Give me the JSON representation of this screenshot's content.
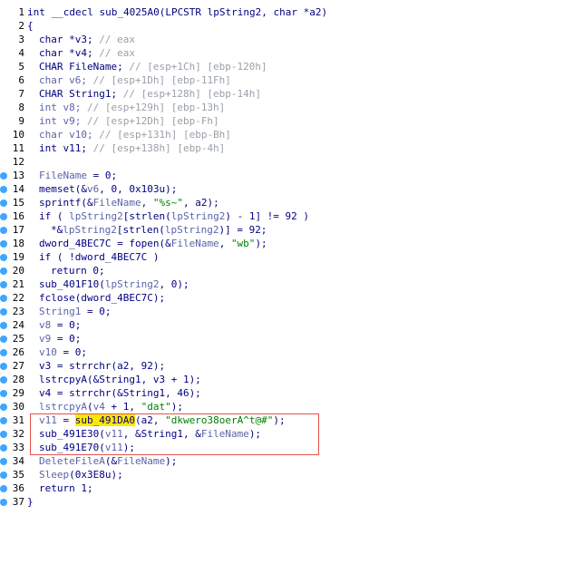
{
  "lines": [
    {
      "n": "1",
      "bp": false,
      "segs": [
        [
          "k",
          "int __cdecl sub_4025A0(LPCSTR lpString2, char *a2)"
        ]
      ]
    },
    {
      "n": "2",
      "bp": false,
      "segs": [
        [
          "k",
          "{"
        ]
      ]
    },
    {
      "n": "3",
      "bp": false,
      "ind": 1,
      "segs": [
        [
          "k",
          "char *v3; "
        ],
        [
          "c",
          "// eax"
        ]
      ]
    },
    {
      "n": "4",
      "bp": false,
      "ind": 1,
      "segs": [
        [
          "k",
          "char *v4; "
        ],
        [
          "c",
          "// eax"
        ]
      ]
    },
    {
      "n": "5",
      "bp": false,
      "ind": 1,
      "segs": [
        [
          "k",
          "CHAR FileName; "
        ],
        [
          "c",
          "// [esp+1Ch] [ebp-120h]"
        ]
      ]
    },
    {
      "n": "6",
      "bp": false,
      "ind": 1,
      "segs": [
        [
          "v",
          "char v6; "
        ],
        [
          "c",
          "// [esp+1Dh] [ebp-11Fh]"
        ]
      ]
    },
    {
      "n": "7",
      "bp": false,
      "ind": 1,
      "segs": [
        [
          "k",
          "CHAR String1; "
        ],
        [
          "c",
          "// [esp+128h] [ebp-14h]"
        ]
      ]
    },
    {
      "n": "8",
      "bp": false,
      "ind": 1,
      "segs": [
        [
          "v",
          "int v8; "
        ],
        [
          "c",
          "// [esp+129h] [ebp-13h]"
        ]
      ]
    },
    {
      "n": "9",
      "bp": false,
      "ind": 1,
      "segs": [
        [
          "v",
          "int v9; "
        ],
        [
          "c",
          "// [esp+12Dh] [ebp-Fh]"
        ]
      ]
    },
    {
      "n": "10",
      "bp": false,
      "ind": 1,
      "segs": [
        [
          "v",
          "char v10; "
        ],
        [
          "c",
          "// [esp+131h] [ebp-Bh]"
        ]
      ]
    },
    {
      "n": "11",
      "bp": false,
      "ind": 1,
      "segs": [
        [
          "k",
          "int v11; "
        ],
        [
          "c",
          "// [esp+138h] [ebp-4h]"
        ]
      ]
    },
    {
      "n": "12",
      "bp": false,
      "segs": [
        [
          "k",
          ""
        ]
      ]
    },
    {
      "n": "13",
      "bp": true,
      "ind": 1,
      "segs": [
        [
          "v",
          "FileName"
        ],
        [
          "k",
          " = 0;"
        ]
      ]
    },
    {
      "n": "14",
      "bp": true,
      "ind": 1,
      "segs": [
        [
          "k",
          "memset(&"
        ],
        [
          "v",
          "v6"
        ],
        [
          "k",
          ", 0, 0x103u);"
        ]
      ]
    },
    {
      "n": "15",
      "bp": true,
      "ind": 1,
      "segs": [
        [
          "k",
          "sprintf(&"
        ],
        [
          "v",
          "FileName"
        ],
        [
          "k",
          ", "
        ],
        [
          "s",
          "\"%s~\""
        ],
        [
          "k",
          ", a2);"
        ]
      ]
    },
    {
      "n": "16",
      "bp": true,
      "ind": 1,
      "segs": [
        [
          "k",
          "if ( "
        ],
        [
          "v",
          "lpString2"
        ],
        [
          "k",
          "[strlen("
        ],
        [
          "v",
          "lpString2"
        ],
        [
          "k",
          ") - 1] != 92 )"
        ]
      ]
    },
    {
      "n": "17",
      "bp": true,
      "ind": 2,
      "segs": [
        [
          "k",
          "*&"
        ],
        [
          "v",
          "lpString2"
        ],
        [
          "k",
          "[strlen("
        ],
        [
          "v",
          "lpString2"
        ],
        [
          "k",
          ")] = 92;"
        ]
      ]
    },
    {
      "n": "18",
      "bp": true,
      "ind": 1,
      "segs": [
        [
          "k",
          "dword_4BEC7C = fopen(&"
        ],
        [
          "v",
          "FileName"
        ],
        [
          "k",
          ", "
        ],
        [
          "s",
          "\"wb\""
        ],
        [
          "k",
          ");"
        ]
      ]
    },
    {
      "n": "19",
      "bp": true,
      "ind": 1,
      "segs": [
        [
          "k",
          "if ( !dword_4BEC7C )"
        ]
      ]
    },
    {
      "n": "20",
      "bp": true,
      "ind": 2,
      "segs": [
        [
          "k",
          "return 0;"
        ]
      ]
    },
    {
      "n": "21",
      "bp": true,
      "ind": 1,
      "segs": [
        [
          "k",
          "sub_401F10("
        ],
        [
          "v",
          "lpString2"
        ],
        [
          "k",
          ", 0);"
        ]
      ]
    },
    {
      "n": "22",
      "bp": true,
      "ind": 1,
      "segs": [
        [
          "k",
          "fclose(dword_4BEC7C);"
        ]
      ]
    },
    {
      "n": "23",
      "bp": true,
      "ind": 1,
      "segs": [
        [
          "v",
          "String1"
        ],
        [
          "k",
          " = 0;"
        ]
      ]
    },
    {
      "n": "24",
      "bp": true,
      "ind": 1,
      "segs": [
        [
          "v",
          "v8"
        ],
        [
          "k",
          " = 0;"
        ]
      ]
    },
    {
      "n": "25",
      "bp": true,
      "ind": 1,
      "segs": [
        [
          "v",
          "v9"
        ],
        [
          "k",
          " = 0;"
        ]
      ]
    },
    {
      "n": "26",
      "bp": true,
      "ind": 1,
      "segs": [
        [
          "v",
          "v10"
        ],
        [
          "k",
          " = 0;"
        ]
      ]
    },
    {
      "n": "27",
      "bp": true,
      "ind": 1,
      "segs": [
        [
          "k",
          "v3 = strrchr(a2, 92);"
        ]
      ]
    },
    {
      "n": "28",
      "bp": true,
      "ind": 1,
      "segs": [
        [
          "k",
          "lstrcpyA(&String1, v3 + 1);"
        ]
      ]
    },
    {
      "n": "29",
      "bp": true,
      "ind": 1,
      "segs": [
        [
          "k",
          "v4 = strrchr(&String1, 46);"
        ]
      ]
    },
    {
      "n": "30",
      "bp": true,
      "ind": 1,
      "segs": [
        [
          "v",
          "lstrcpyA"
        ],
        [
          "k",
          "("
        ],
        [
          "v",
          "v4"
        ],
        [
          "k",
          " + 1, "
        ],
        [
          "s",
          "\"dat\""
        ],
        [
          "k",
          ");"
        ]
      ]
    },
    {
      "n": "31",
      "bp": true,
      "ind": 1,
      "segs": [
        [
          "v",
          "v11"
        ],
        [
          "k",
          " = "
        ],
        [
          "hl",
          "sub_491DA0"
        ],
        [
          "k",
          "(a2, "
        ],
        [
          "s",
          "\"dkwero38oerA^t@#\""
        ],
        [
          "k",
          ");"
        ]
      ]
    },
    {
      "n": "32",
      "bp": true,
      "ind": 1,
      "segs": [
        [
          "k",
          "sub_491E30("
        ],
        [
          "v",
          "v11"
        ],
        [
          "k",
          ", &String1, &"
        ],
        [
          "v",
          "FileName"
        ],
        [
          "k",
          ");"
        ]
      ]
    },
    {
      "n": "33",
      "bp": true,
      "ind": 1,
      "segs": [
        [
          "k",
          "sub_491E70("
        ],
        [
          "v",
          "v11"
        ],
        [
          "k",
          ");"
        ]
      ]
    },
    {
      "n": "34",
      "bp": true,
      "ind": 1,
      "segs": [
        [
          "v",
          "DeleteFileA"
        ],
        [
          "k",
          "(&"
        ],
        [
          "v",
          "FileName"
        ],
        [
          "k",
          ");"
        ]
      ]
    },
    {
      "n": "35",
      "bp": true,
      "ind": 1,
      "segs": [
        [
          "v",
          "Sleep"
        ],
        [
          "k",
          "(0x3E8u);"
        ]
      ]
    },
    {
      "n": "36",
      "bp": true,
      "ind": 1,
      "segs": [
        [
          "k",
          "return 1;"
        ]
      ]
    },
    {
      "n": "37",
      "bp": true,
      "segs": [
        [
          "k",
          "}"
        ]
      ]
    }
  ],
  "colors": {
    "code": "#000080",
    "comment": "#9aa0a8",
    "variable": "#5a64a8",
    "string": "#008000",
    "highlight": "#ffe800",
    "breakpoint": "#3ea6ff",
    "annotation_box": "#e8504a"
  }
}
